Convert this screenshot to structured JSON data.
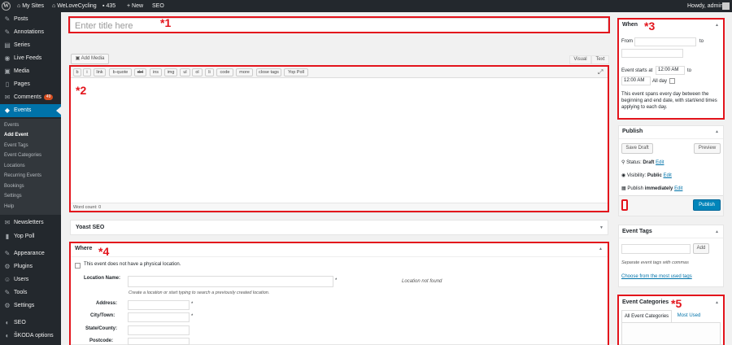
{
  "adminbar": {
    "my_sites": "My Sites",
    "site_name": "WeLoveCycling",
    "comments_count": "435",
    "new_label": "New",
    "seo_label": "SEO",
    "howdy": "Howdy, admin"
  },
  "sidebar": {
    "items": [
      {
        "icon": "✎",
        "label": "Posts"
      },
      {
        "icon": "✎",
        "label": "Annotations"
      },
      {
        "icon": "▤",
        "label": "Series"
      },
      {
        "icon": "◉",
        "label": "Live Feeds"
      },
      {
        "icon": "▣",
        "label": "Media"
      },
      {
        "icon": "▯",
        "label": "Pages"
      },
      {
        "icon": "✉",
        "label": "Comments",
        "badge": "49"
      },
      {
        "icon": "◆",
        "label": "Events"
      }
    ],
    "submenu": [
      "Events",
      "Add Event",
      "Event Tags",
      "Event Categories",
      "Locations",
      "Recurring Events",
      "Bookings",
      "Settings",
      "Help"
    ],
    "items2": [
      {
        "icon": "✉",
        "label": "Newsletters"
      },
      {
        "icon": "▮",
        "label": "Yop Poll"
      },
      {
        "icon": "✎",
        "label": "Appearance"
      },
      {
        "icon": "⚙",
        "label": "Plugins"
      },
      {
        "icon": "☺",
        "label": "Users"
      },
      {
        "icon": "✎",
        "label": "Tools"
      },
      {
        "icon": "⚙",
        "label": "Settings"
      },
      {
        "icon": "◐",
        "label": "SEO"
      },
      {
        "icon": "◐",
        "label": "ŠKODA options"
      }
    ]
  },
  "editor": {
    "title_placeholder": "Enter title here",
    "add_media": "Add Media",
    "tab_visual": "Visual",
    "tab_text": "Text",
    "quicktags": [
      "b",
      "i",
      "link",
      "b-quote",
      "del",
      "ins",
      "img",
      "ul",
      "ol",
      "li",
      "code",
      "more",
      "close tags",
      "Yop Poll"
    ],
    "word_count": "Word count: 0"
  },
  "annotations": [
    "*1",
    "*2",
    "*3",
    "*4",
    "*5"
  ],
  "yoast": {
    "title": "Yoast SEO"
  },
  "where": {
    "title": "Where",
    "no_location": "This event does not have a physical location.",
    "location_name": "Location Name:",
    "location_hint": "Create a location or start typing to search a previously created location.",
    "location_not_found": "Location not found",
    "address": "Address:",
    "city": "City/Town:",
    "state": "State/County:",
    "postcode": "Postcode:",
    "required": "*"
  },
  "when": {
    "title": "When",
    "from": "From",
    "to": "to",
    "event_starts_at": "Event starts at",
    "start_time": "12:00 AM",
    "to2": "to",
    "end_time": "12:00 AM",
    "all_day": "All day",
    "note": "This event spans every day between the beginning and end date, with start/end times applying to each day."
  },
  "publish": {
    "title": "Publish",
    "save_draft": "Save Draft",
    "preview": "Preview",
    "status_label": "Status:",
    "status_value": "Draft",
    "edit": "Edit",
    "visibility_label": "Visibility:",
    "visibility_value": "Public",
    "publish_label": "Publish",
    "publish_value": "immediately",
    "publish_button": "Publish"
  },
  "event_tags": {
    "title": "Event Tags",
    "add": "Add",
    "hint": "Separate event tags with commas",
    "choose": "Choose from the most used tags"
  },
  "event_categories": {
    "title": "Event Categories",
    "tab_all": "All Event Categories",
    "tab_used": "Most Used"
  },
  "colors": {
    "accent": "#0073aa",
    "annotation": "#e3141c",
    "adminbar": "#23282d"
  }
}
